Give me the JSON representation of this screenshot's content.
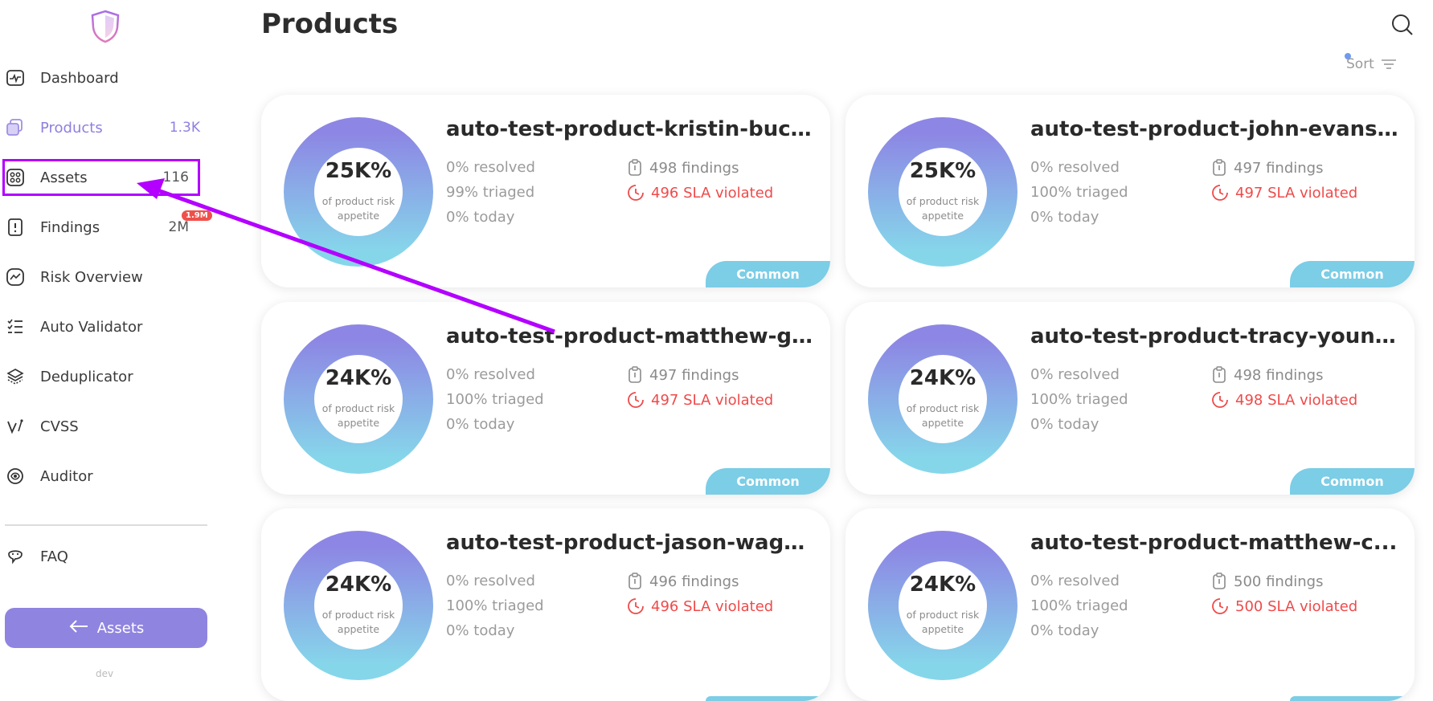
{
  "app": {
    "page_title": "Products",
    "env_label": "dev"
  },
  "colors": {
    "accent": "#8f84e0",
    "annotation": "#b300ff",
    "danger": "#ef4a4a",
    "tag": "#7ccde6"
  },
  "sidebar": {
    "items": [
      {
        "label": "Dashboard",
        "count": "",
        "icon": "dashboard-icon"
      },
      {
        "label": "Products",
        "count": "1.3K",
        "icon": "products-icon"
      },
      {
        "label": "Assets",
        "count": "116",
        "icon": "assets-icon"
      },
      {
        "label": "Findings",
        "count": "2M",
        "icon": "findings-icon",
        "badge": "1.9M"
      },
      {
        "label": "Risk Overview",
        "count": "",
        "icon": "risk-overview-icon"
      },
      {
        "label": "Auto Validator",
        "count": "",
        "icon": "auto-validator-icon"
      },
      {
        "label": "Deduplicator",
        "count": "",
        "icon": "deduplicator-icon"
      },
      {
        "label": "CVSS",
        "count": "",
        "icon": "cvss-icon"
      },
      {
        "label": "Auditor",
        "count": "",
        "icon": "auditor-icon"
      },
      {
        "label": "FAQ",
        "count": "",
        "icon": "faq-icon"
      }
    ],
    "back_button": "Assets"
  },
  "toolbar": {
    "sort_label": "Sort"
  },
  "products": [
    {
      "title": "auto-test-product-kristin-buck...",
      "risk": "25K%",
      "caption": "of product risk appetite",
      "resolved": "0% resolved",
      "triaged": "99% triaged",
      "today": "0% today",
      "findings": "498 findings",
      "sla": "496 SLA violated",
      "tag": "Common"
    },
    {
      "title": "auto-test-product-john-evans-...",
      "risk": "25K%",
      "caption": "of product risk appetite",
      "resolved": "0% resolved",
      "triaged": "100% triaged",
      "today": "0% today",
      "findings": "497 findings",
      "sla": "497 SLA violated",
      "tag": "Common"
    },
    {
      "title": "auto-test-product-matthew-gr...",
      "risk": "24K%",
      "caption": "of product risk appetite",
      "resolved": "0% resolved",
      "triaged": "100% triaged",
      "today": "0% today",
      "findings": "497 findings",
      "sla": "497 SLA violated",
      "tag": "Common"
    },
    {
      "title": "auto-test-product-tracy-young...",
      "risk": "24K%",
      "caption": "of product risk appetite",
      "resolved": "0% resolved",
      "triaged": "100% triaged",
      "today": "0% today",
      "findings": "498 findings",
      "sla": "498 SLA violated",
      "tag": "Common"
    },
    {
      "title": "auto-test-product-jason-wagn...",
      "risk": "24K%",
      "caption": "of product risk appetite",
      "resolved": "0% resolved",
      "triaged": "100% triaged",
      "today": "0% today",
      "findings": "496 findings",
      "sla": "496 SLA violated",
      "tag": ""
    },
    {
      "title": "auto-test-product-matthew-c...",
      "risk": "24K%",
      "caption": "of product risk appetite",
      "resolved": "0% resolved",
      "triaged": "100% triaged",
      "today": "0% today",
      "findings": "500 findings",
      "sla": "500 SLA violated",
      "tag": ""
    }
  ]
}
